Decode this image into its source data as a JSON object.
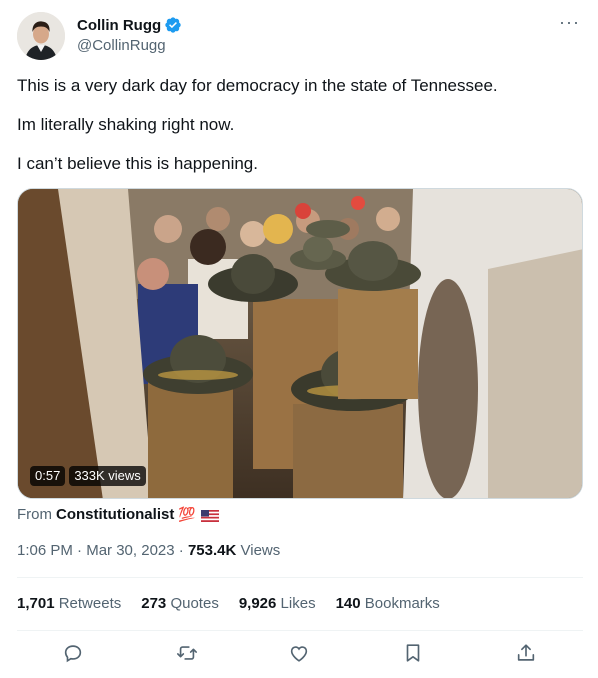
{
  "author": {
    "display_name": "Collin Rugg",
    "handle": "@CollinRugg",
    "verified": true
  },
  "more_icon": "···",
  "tweet_text": [
    "This is a very dark day for democracy in the state of Tennessee.",
    "Im literally shaking right now.",
    "I can’t believe this is happening."
  ],
  "video": {
    "duration": "0:57",
    "views": "333K views"
  },
  "source": {
    "prefix": "From",
    "account": "Constitutionalist",
    "emoji": "💯"
  },
  "meta": {
    "time": "1:06 PM",
    "separator": "·",
    "date": "Mar 30, 2023",
    "views_count": "753.4K",
    "views_label": "Views"
  },
  "stats": [
    {
      "count": "1,701",
      "label": "Retweets"
    },
    {
      "count": "273",
      "label": "Quotes"
    },
    {
      "count": "9,926",
      "label": "Likes"
    },
    {
      "count": "140",
      "label": "Bookmarks"
    }
  ],
  "colors": {
    "verified": "#1d9bf0",
    "text_primary": "#0f1419",
    "text_secondary": "#536471",
    "divider": "#eff3f4"
  },
  "actions": [
    "reply-icon",
    "retweet-icon",
    "like-icon",
    "bookmark-icon",
    "share-icon"
  ]
}
